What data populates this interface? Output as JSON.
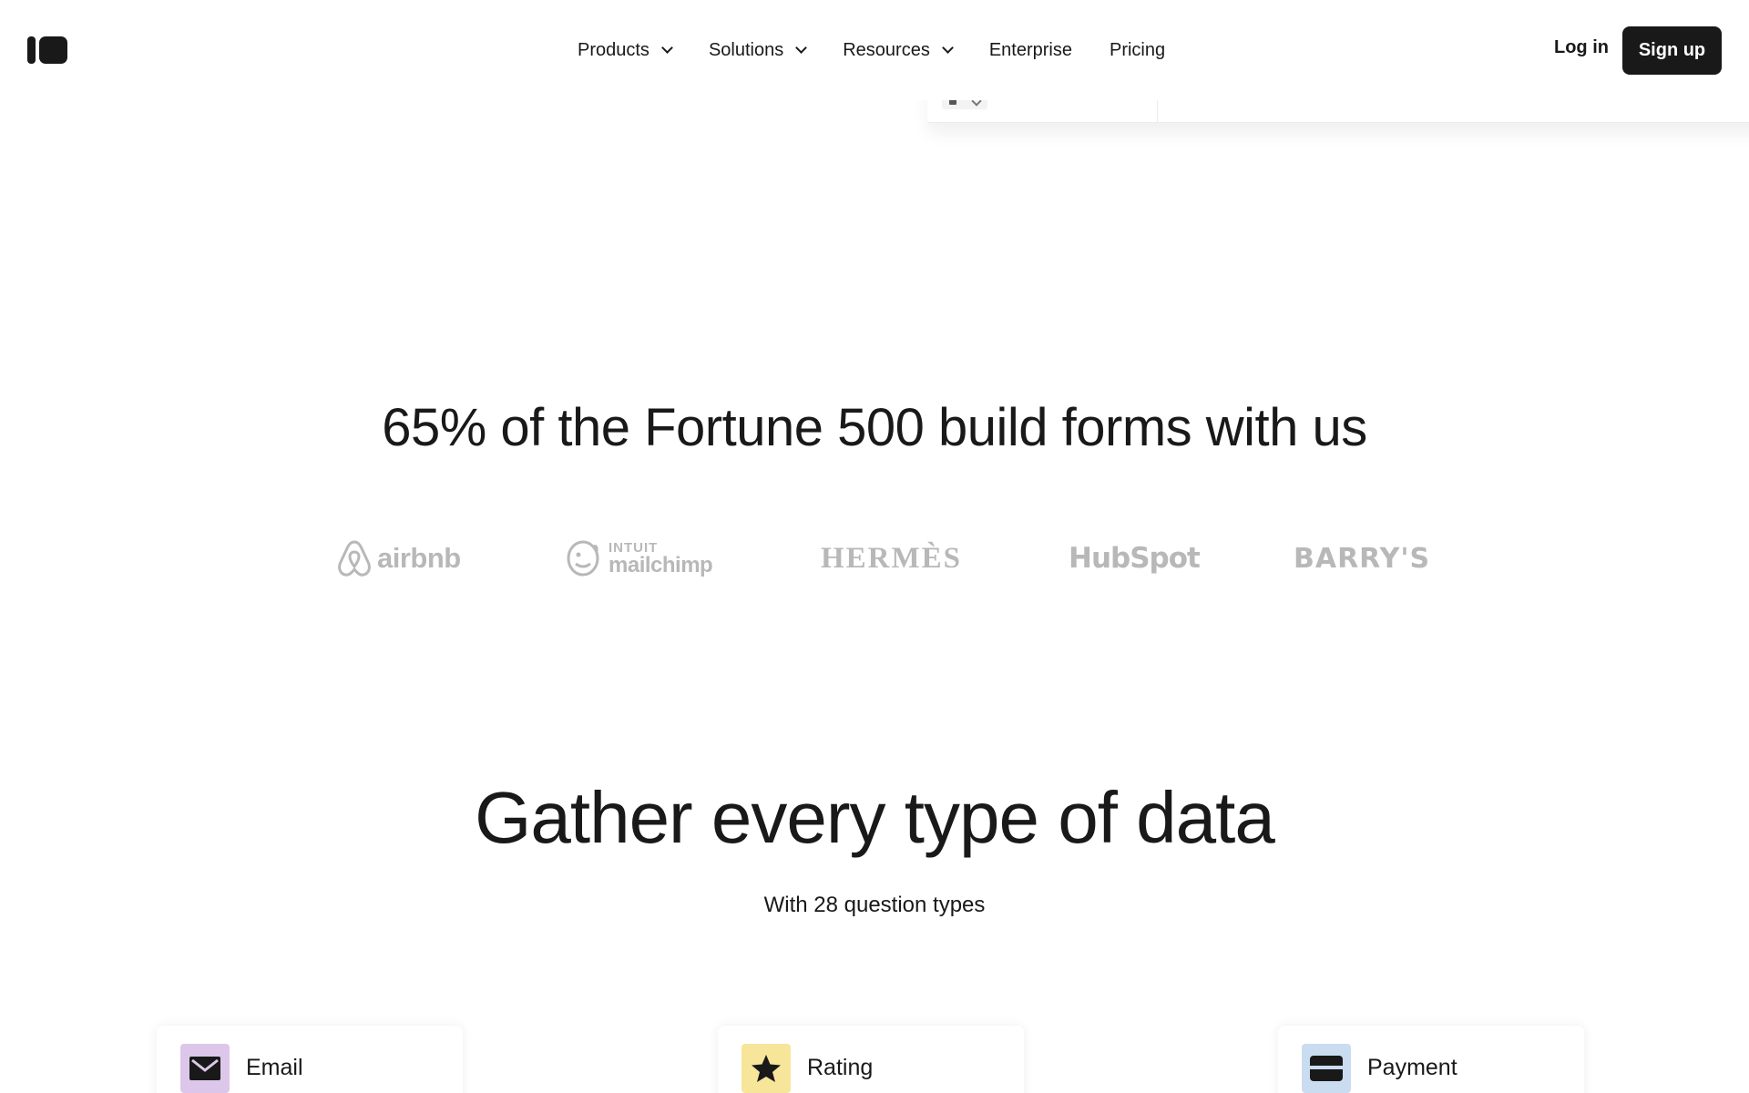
{
  "nav": {
    "items": [
      {
        "label": "Products",
        "has_dropdown": true
      },
      {
        "label": "Solutions",
        "has_dropdown": true
      },
      {
        "label": "Resources",
        "has_dropdown": true
      },
      {
        "label": "Enterprise",
        "has_dropdown": false
      },
      {
        "label": "Pricing",
        "has_dropdown": false
      }
    ],
    "login_label": "Log in",
    "signup_label": "Sign up"
  },
  "social_proof": {
    "title": "65% of the Fortune 500 build forms with us",
    "logos": [
      {
        "name": "airbnb",
        "icon": "airbnb-logo"
      },
      {
        "name": "mailchimp",
        "small": "INTUIT",
        "big": "mailchimp",
        "icon": "mailchimp-logo"
      },
      {
        "name": "HERMÈS",
        "icon": "hermes-logo"
      },
      {
        "name": "HubSpot",
        "icon": "hubspot-logo"
      },
      {
        "name": "BARRY'S",
        "icon": "barrys-logo"
      }
    ]
  },
  "gather": {
    "title": "Gather every type of data",
    "subtitle": "With 28 question types"
  },
  "question_types": [
    {
      "label": "Email",
      "icon": "envelope-icon",
      "color": "#dcc7ea"
    },
    {
      "label": "Rating",
      "icon": "star-icon",
      "color": "#f7e59a"
    },
    {
      "label": "Payment",
      "icon": "credit-card-icon",
      "color": "#c9dcf0"
    }
  ],
  "colors": {
    "text": "#191919",
    "button_bg": "#191919",
    "button_text": "#ffffff",
    "logo_gray": "#b8b8b8"
  }
}
